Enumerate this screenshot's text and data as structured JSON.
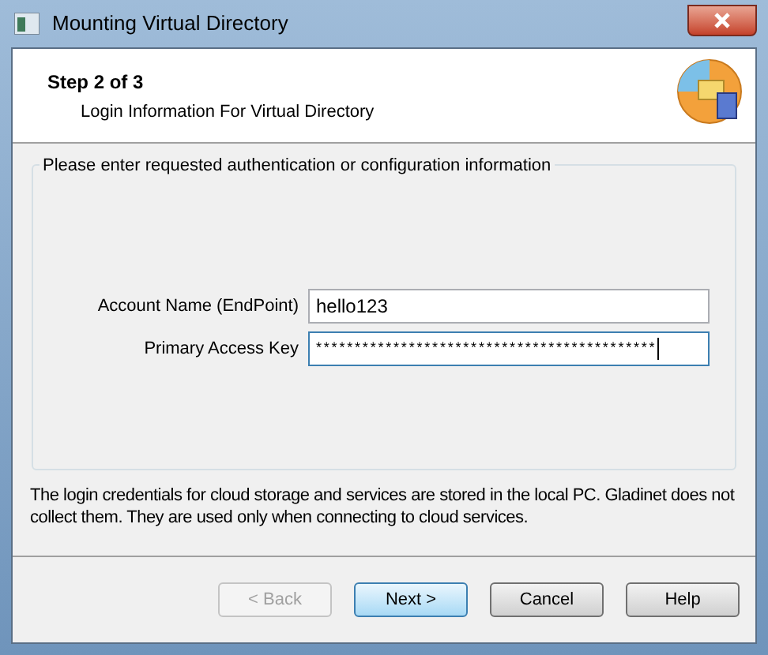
{
  "window": {
    "title": "Mounting Virtual Directory"
  },
  "header": {
    "step": "Step 2 of 3",
    "subtitle": "Login Information For Virtual Directory"
  },
  "group": {
    "legend": "Please enter requested authentication or configuration information",
    "fields": [
      {
        "label": "Account Name (EndPoint)",
        "value": "hello123",
        "focused": false
      },
      {
        "label": "Primary Access Key",
        "value": "********************************************",
        "focused": true
      }
    ]
  },
  "note": "The login credentials for cloud storage and services are stored in the local PC. Gladinet does not collect them. They are used only when connecting to cloud services.",
  "buttons": [
    {
      "label": "< Back",
      "disabled": true,
      "default": false
    },
    {
      "label": "Next >",
      "disabled": false,
      "default": true
    },
    {
      "label": "Cancel",
      "disabled": false,
      "default": false
    },
    {
      "label": "Help",
      "disabled": false,
      "default": false
    }
  ]
}
